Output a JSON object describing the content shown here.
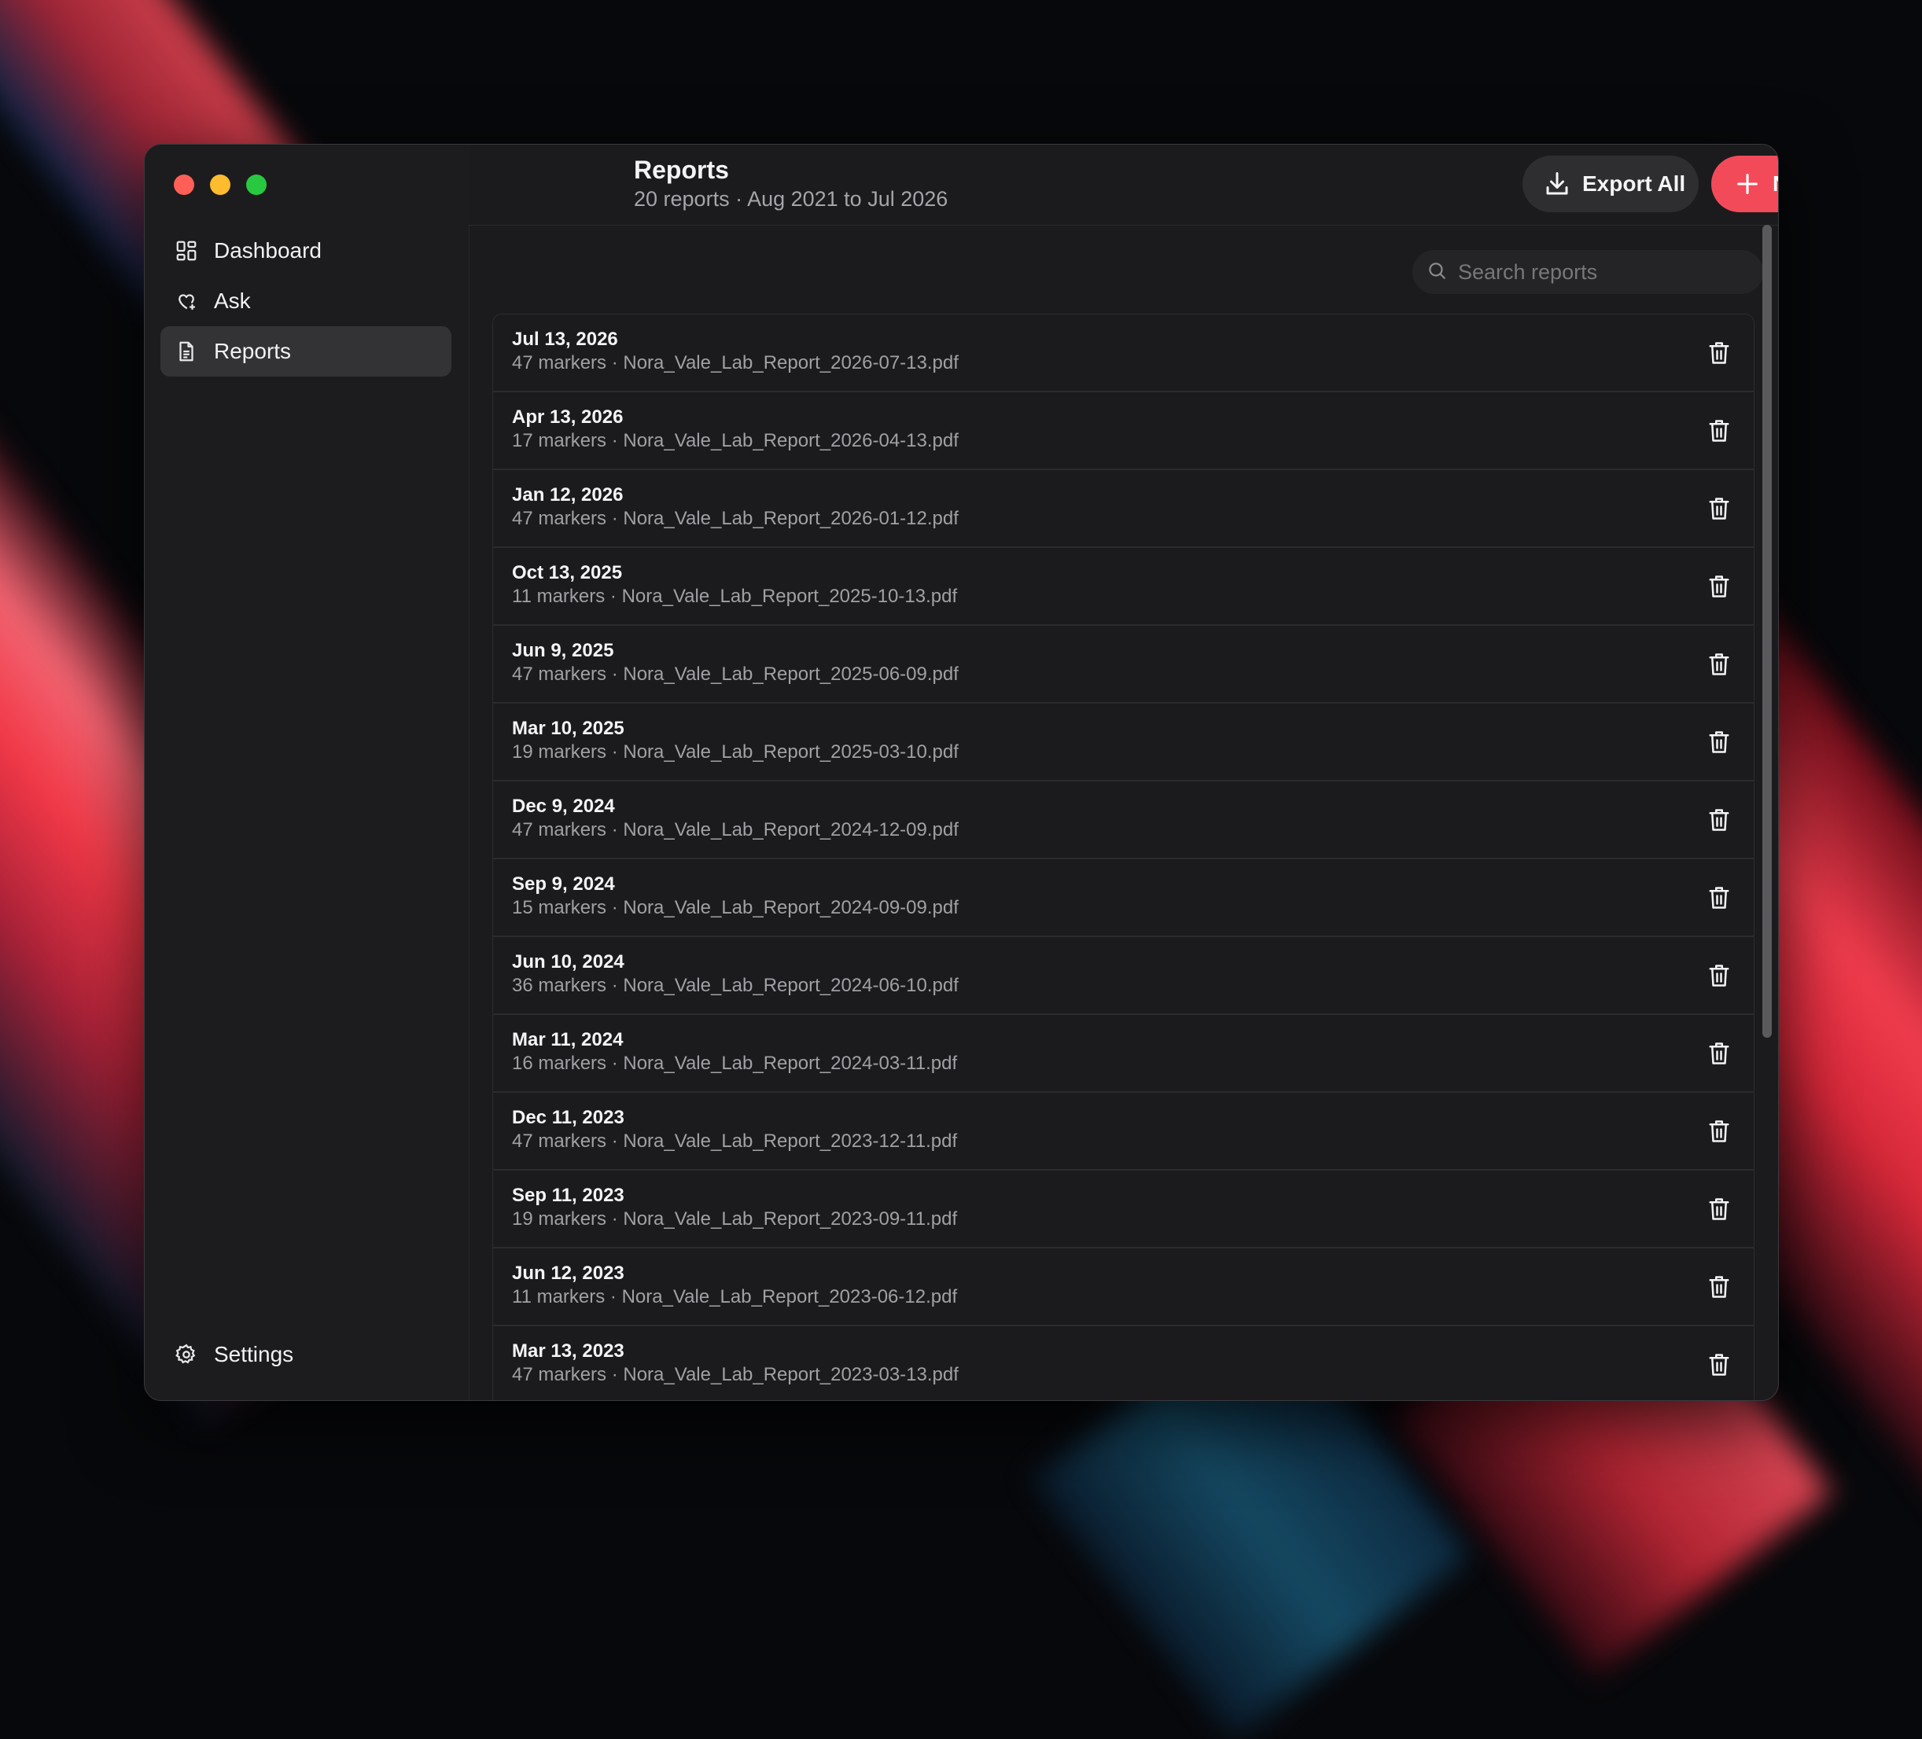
{
  "window": {
    "title": "Reports",
    "subtitle": "20 reports · Aug 2021 to Jul 2026"
  },
  "sidebar": {
    "items": [
      {
        "label": "Dashboard",
        "icon": "grid-icon"
      },
      {
        "label": "Ask",
        "icon": "heart-sparkle-icon"
      },
      {
        "label": "Reports",
        "icon": "document-icon",
        "active": true
      }
    ],
    "settings_label": "Settings"
  },
  "toolbar": {
    "export_label": "Export All",
    "new_label": "New Report"
  },
  "search": {
    "placeholder": "Search reports"
  },
  "reports": [
    {
      "date": "Jul 13, 2026",
      "meta": "47 markers · Nora_Vale_Lab_Report_2026-07-13.pdf"
    },
    {
      "date": "Apr 13, 2026",
      "meta": "17 markers · Nora_Vale_Lab_Report_2026-04-13.pdf"
    },
    {
      "date": "Jan 12, 2026",
      "meta": "47 markers · Nora_Vale_Lab_Report_2026-01-12.pdf"
    },
    {
      "date": "Oct 13, 2025",
      "meta": "11 markers · Nora_Vale_Lab_Report_2025-10-13.pdf"
    },
    {
      "date": "Jun 9, 2025",
      "meta": "47 markers · Nora_Vale_Lab_Report_2025-06-09.pdf"
    },
    {
      "date": "Mar 10, 2025",
      "meta": "19 markers · Nora_Vale_Lab_Report_2025-03-10.pdf"
    },
    {
      "date": "Dec 9, 2024",
      "meta": "47 markers · Nora_Vale_Lab_Report_2024-12-09.pdf"
    },
    {
      "date": "Sep 9, 2024",
      "meta": "15 markers · Nora_Vale_Lab_Report_2024-09-09.pdf"
    },
    {
      "date": "Jun 10, 2024",
      "meta": "36 markers · Nora_Vale_Lab_Report_2024-06-10.pdf"
    },
    {
      "date": "Mar 11, 2024",
      "meta": "16 markers · Nora_Vale_Lab_Report_2024-03-11.pdf"
    },
    {
      "date": "Dec 11, 2023",
      "meta": "47 markers · Nora_Vale_Lab_Report_2023-12-11.pdf"
    },
    {
      "date": "Sep 11, 2023",
      "meta": "19 markers · Nora_Vale_Lab_Report_2023-09-11.pdf"
    },
    {
      "date": "Jun 12, 2023",
      "meta": "11 markers · Nora_Vale_Lab_Report_2023-06-12.pdf"
    },
    {
      "date": "Mar 13, 2023",
      "meta": "47 markers · Nora_Vale_Lab_Report_2023-03-13.pdf"
    }
  ],
  "colors": {
    "accent": "#f34a5a",
    "window_bg": "#1b1b1d",
    "active_nav": "#333336"
  }
}
